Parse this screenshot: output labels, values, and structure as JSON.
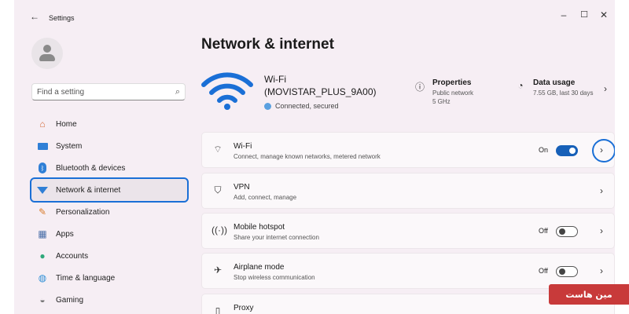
{
  "window": {
    "app_title": "Settings",
    "back_icon": "back-arrow-icon",
    "controls": [
      "minimize-icon",
      "maximize-icon",
      "close-icon"
    ]
  },
  "sidebar": {
    "search_placeholder": "Find a setting",
    "items": [
      {
        "label": "Home",
        "icon": "home-icon",
        "active": false
      },
      {
        "label": "System",
        "icon": "monitor-icon",
        "active": false
      },
      {
        "label": "Bluetooth & devices",
        "icon": "bluetooth-icon",
        "active": false
      },
      {
        "label": "Network & internet",
        "icon": "wifi-icon",
        "active": true
      },
      {
        "label": "Personalization",
        "icon": "brush-icon",
        "active": false
      },
      {
        "label": "Apps",
        "icon": "apps-icon",
        "active": false
      },
      {
        "label": "Accounts",
        "icon": "person-icon",
        "active": false
      },
      {
        "label": "Time & language",
        "icon": "globe-icon",
        "active": false
      },
      {
        "label": "Gaming",
        "icon": "gamepad-icon",
        "active": false
      }
    ]
  },
  "main": {
    "title": "Network & internet",
    "hero": {
      "ssid_line1": "Wi-Fi",
      "ssid_line2": "(MOVISTAR_PLUS_9A00)",
      "status": "Connected, secured",
      "properties": {
        "title": "Properties",
        "line1": "Public network",
        "line2": "5 GHz"
      },
      "data_usage": {
        "title": "Data usage",
        "line1": "7.55 GB, last 30 days"
      }
    },
    "cards": [
      {
        "title": "Wi-Fi",
        "subtitle": "Connect, manage known networks, metered network",
        "icon": "wifi-icon",
        "state": "On",
        "toggle": true,
        "toggle_on": true
      },
      {
        "title": "VPN",
        "subtitle": "Add, connect, manage",
        "icon": "shield-icon",
        "state": "",
        "toggle": false,
        "toggle_on": false
      },
      {
        "title": "Mobile hotspot",
        "subtitle": "Share your internet connection",
        "icon": "hotspot-icon",
        "state": "Off",
        "toggle": true,
        "toggle_on": false
      },
      {
        "title": "Airplane mode",
        "subtitle": "Stop wireless communication",
        "icon": "airplane-icon",
        "state": "Off",
        "toggle": true,
        "toggle_on": false
      },
      {
        "title": "Proxy",
        "subtitle": "",
        "icon": "proxy-icon",
        "state": "",
        "toggle": false,
        "toggle_on": false
      }
    ]
  },
  "watermark": "مین هاست",
  "colors": {
    "accent": "#1760b8",
    "highlight": "#1a6fd6",
    "background": "#f6eef4",
    "watermark": "#c83a3a"
  }
}
